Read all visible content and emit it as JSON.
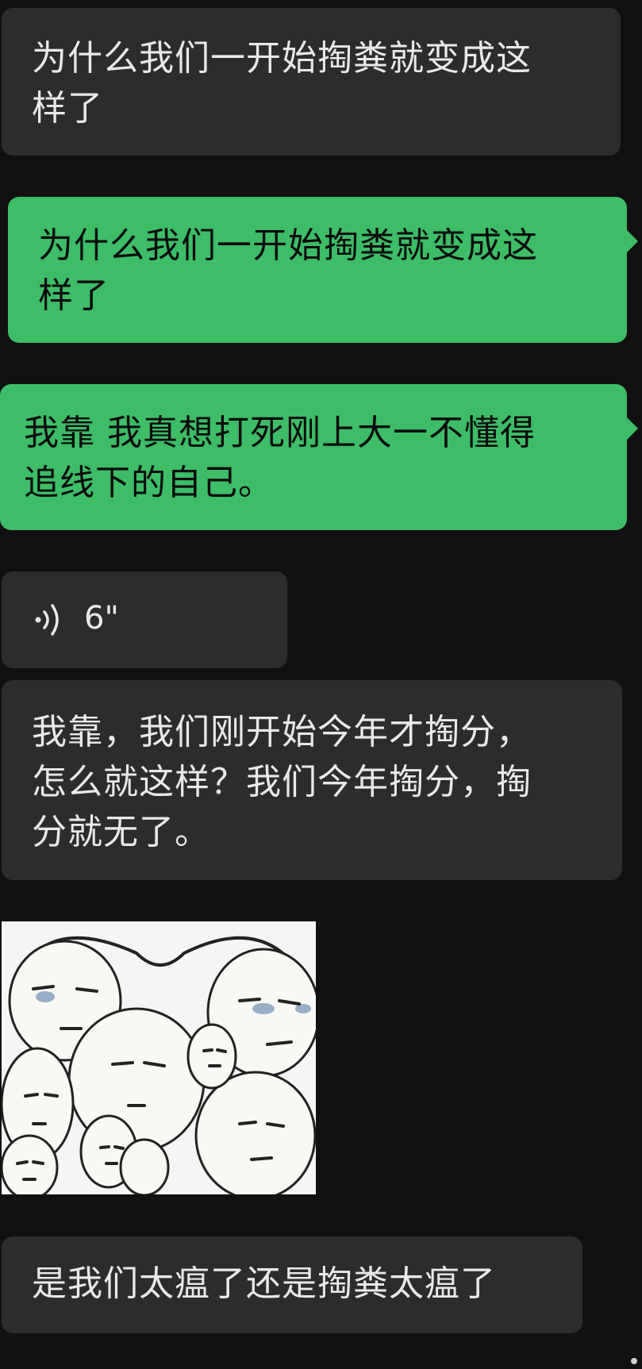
{
  "messages": [
    {
      "side": "received",
      "text": "为什么我们一开始掏粪就变成这\n样了"
    },
    {
      "side": "sent",
      "text": "为什么我们一开始掏粪就变成这\n样了"
    },
    {
      "side": "sent",
      "text": "我靠 我真想打死刚上大一不懂得\n追线下的自己。"
    },
    {
      "side": "received",
      "type": "voice",
      "duration": "6\""
    },
    {
      "side": "received",
      "text": "我靠，我们刚开始今年才掏分，\n怎么就这样？我们今年掏分，掏\n分就无了。"
    },
    {
      "side": "received",
      "type": "image",
      "description_icon": "crying-faces-meme-image"
    },
    {
      "side": "received",
      "text": "是我们太瘟了还是掏粪太瘟了"
    }
  ],
  "colors": {
    "background": "#111111",
    "received_bubble": "#2c2c2c",
    "sent_bubble": "#3dbd66",
    "received_text": "#e9e9e9",
    "sent_text": "#0b0b0b"
  }
}
